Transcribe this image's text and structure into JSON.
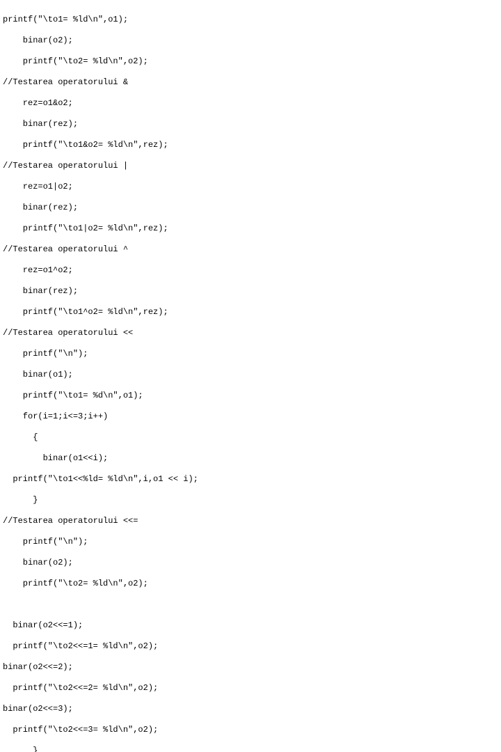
{
  "code": {
    "lines": [
      "printf(\"\\to1= %ld\\n\",o1);",
      "    binar(o2);",
      "    printf(\"\\to2= %ld\\n\",o2);",
      "//Testarea operatorului &",
      "    rez=o1&o2;",
      "    binar(rez);",
      "    printf(\"\\to1&o2= %ld\\n\",rez);",
      "//Testarea operatorului |",
      "    rez=o1|o2;",
      "    binar(rez);",
      "    printf(\"\\to1|o2= %ld\\n\",rez);",
      "//Testarea operatorului ^",
      "    rez=o1^o2;",
      "    binar(rez);",
      "    printf(\"\\to1^o2= %ld\\n\",rez);",
      "//Testarea operatorului <<",
      "    printf(\"\\n\");",
      "    binar(o1);",
      "    printf(\"\\to1= %d\\n\",o1);",
      "    for(i=1;i<=3;i++)",
      "      {",
      "        binar(o1<<i);",
      "  printf(\"\\to1<<%ld= %ld\\n\",i,o1 << i);",
      "      }",
      "//Testarea operatorului <<=",
      "    printf(\"\\n\");",
      "    binar(o2);",
      "    printf(\"\\to2= %ld\\n\",o2);",
      "                                   ",
      "  binar(o2<<=1);",
      "  printf(\"\\to2<<=1= %ld\\n\",o2);",
      "binar(o2<<=2);",
      "  printf(\"\\to2<<=2= %ld\\n\",o2);",
      "binar(o2<<=3);",
      "  printf(\"\\to2<<=3= %ld\\n\",o2);",
      "      }"
    ]
  }
}
